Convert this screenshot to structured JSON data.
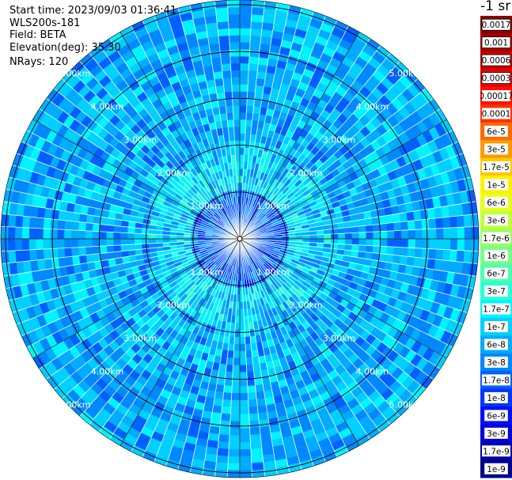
{
  "header": {
    "start_time": "Start time: 2023/09/03 01:36:41",
    "device": "WLS200s-181",
    "field": "Field: BETA",
    "elevation": "Elevation(deg): 35.30",
    "nrays": "NRays: 120"
  },
  "chart_data": {
    "type": "heatmap",
    "projection": "polar-ppi",
    "n_rays": 120,
    "range_rings_km": [
      1,
      2,
      3,
      4,
      5
    ],
    "ring_labels": [
      "1.00km",
      "2.00km",
      "3.00km",
      "4.00km",
      "5.00km"
    ],
    "max_range_km": 5.1,
    "spoke_angles_deg": [
      0,
      30,
      60,
      90,
      120,
      150,
      180,
      210,
      240,
      270,
      300,
      330
    ],
    "colorbar": {
      "unit_label": "-1 sr",
      "scale": "log",
      "tick_labels": [
        "0.0017",
        "0.001",
        "0.0006",
        "0.0003",
        "0.00017",
        "0.0001",
        "6e-5",
        "3e-5",
        "1.7e-5",
        "1e-5",
        "6e-6",
        "3e-6",
        "1.7e-6",
        "1e-6",
        "6e-7",
        "3e-7",
        "1.7e-7",
        "1e-7",
        "6e-8",
        "3e-8",
        "1.7e-8",
        "1e-8",
        "6e-9",
        "3e-9",
        "1.7e-9",
        "1e-9"
      ],
      "colors": [
        "#8b0000",
        "#a80000",
        "#c80000",
        "#e60000",
        "#ff1000",
        "#ff3000",
        "#ff6a00",
        "#ff9a00",
        "#ffc800",
        "#fff000",
        "#e6ff1a",
        "#c0ff3e",
        "#9bff64",
        "#76ff89",
        "#4dffb0",
        "#2affd4",
        "#00f4ff",
        "#00d0ff",
        "#00acff",
        "#0088ff",
        "#0060ff",
        "#0036ff",
        "#0010f8",
        "#0000d8",
        "#0000b0",
        "#00008a"
      ],
      "boxed_labels": [
        "0.0017",
        "0.001",
        "0.0006",
        "0.0003"
      ]
    },
    "field_structure": {
      "near_range_km": [
        0,
        1.0
      ],
      "near_range_level_index": 20,
      "enhanced_band_km": [
        1.0,
        2.0
      ],
      "enhanced_band_level_index": 17,
      "far_range_km": [
        2.0,
        5.1
      ],
      "far_range_level_index": 18,
      "level_spread": 2
    }
  }
}
